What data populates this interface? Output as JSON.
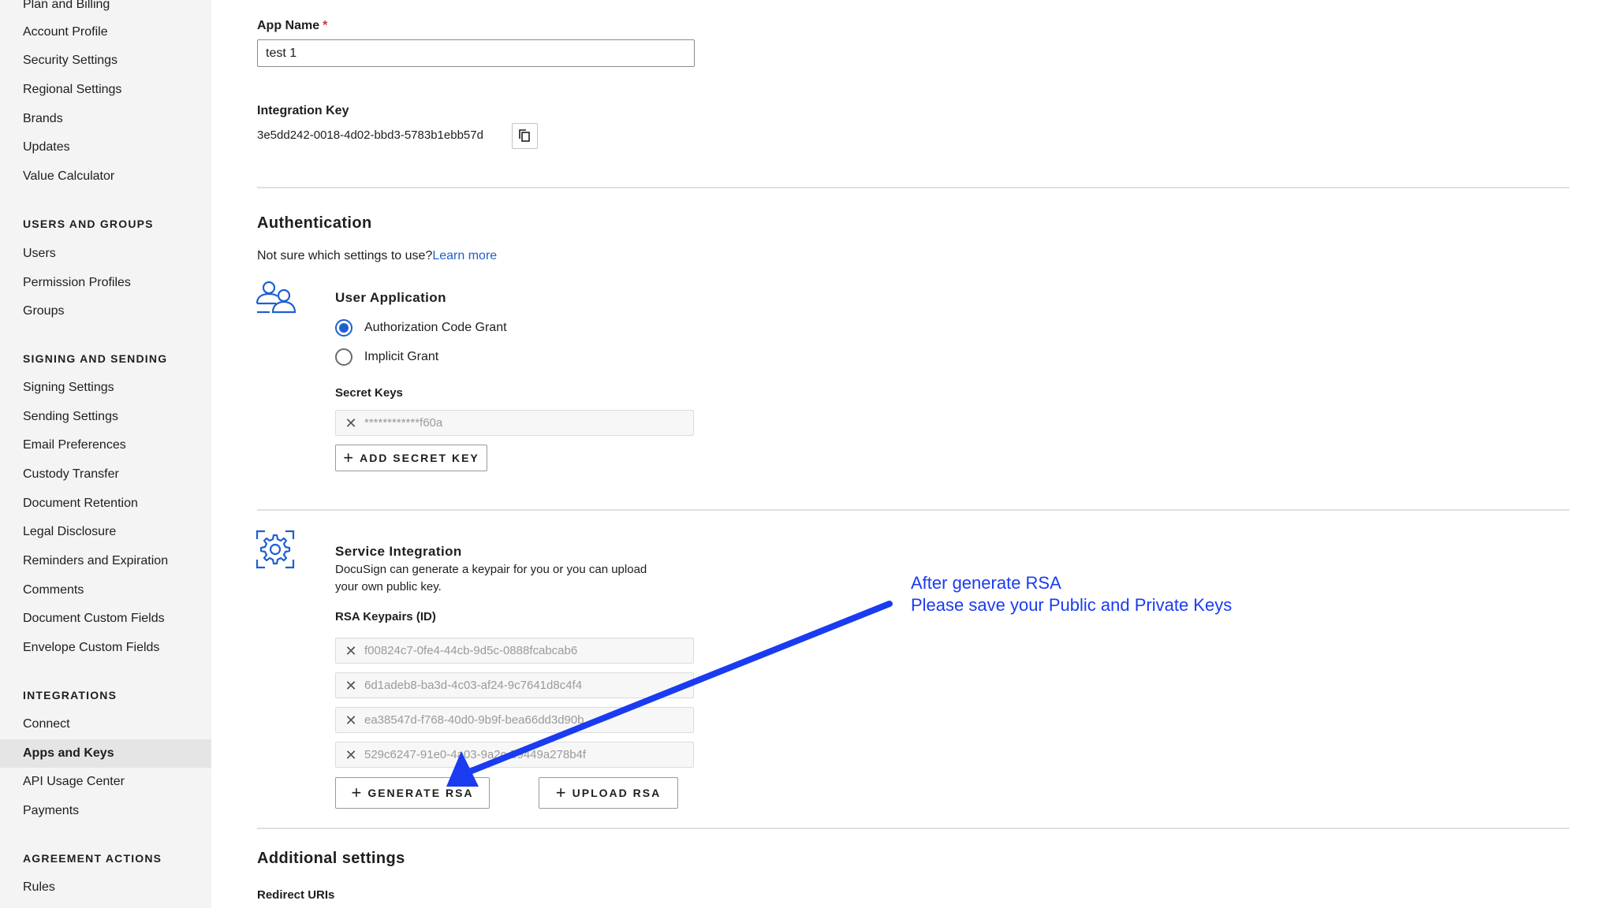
{
  "sidebar": {
    "items_top": [
      {
        "label": "Plan and Billing"
      },
      {
        "label": "Account Profile"
      },
      {
        "label": "Security Settings"
      },
      {
        "label": "Regional Settings"
      },
      {
        "label": "Brands"
      },
      {
        "label": "Updates"
      },
      {
        "label": "Value Calculator"
      }
    ],
    "users_groups": {
      "header": "USERS AND GROUPS",
      "items": [
        {
          "label": "Users"
        },
        {
          "label": "Permission Profiles"
        },
        {
          "label": "Groups"
        }
      ]
    },
    "signing_sending": {
      "header": "SIGNING AND SENDING",
      "items": [
        {
          "label": "Signing Settings"
        },
        {
          "label": "Sending Settings"
        },
        {
          "label": "Email Preferences"
        },
        {
          "label": "Custody Transfer"
        },
        {
          "label": "Document Retention"
        },
        {
          "label": "Legal Disclosure"
        },
        {
          "label": "Reminders and Expiration"
        },
        {
          "label": "Comments"
        },
        {
          "label": "Document Custom Fields"
        },
        {
          "label": "Envelope Custom Fields"
        }
      ]
    },
    "integrations": {
      "header": "INTEGRATIONS",
      "items": [
        {
          "label": "Connect"
        },
        {
          "label": "Apps and Keys",
          "active": true
        },
        {
          "label": "API Usage Center"
        },
        {
          "label": "Payments"
        }
      ]
    },
    "agreement_actions": {
      "header": "AGREEMENT ACTIONS",
      "items": [
        {
          "label": "Rules"
        }
      ]
    }
  },
  "app_name": {
    "label": "App Name",
    "required_mark": "*",
    "value": "test 1"
  },
  "integration_key": {
    "label": "Integration Key",
    "value": "3e5dd242-0018-4d02-bbd3-5783b1ebb57d",
    "copy_icon": "copy-icon"
  },
  "authentication": {
    "title": "Authentication",
    "help_text": "Not sure which settings to use?",
    "learn_more": "Learn more",
    "user_application": {
      "icon": "users-icon",
      "title": "User Application",
      "options": [
        {
          "label": "Authorization Code Grant",
          "checked": true
        },
        {
          "label": "Implicit Grant",
          "checked": false
        }
      ],
      "secret_keys_label": "Secret Keys",
      "secret_keys": [
        "************f60a"
      ],
      "add_secret_key": "ADD SECRET KEY"
    }
  },
  "service_integration": {
    "icon": "gear-icon",
    "title": "Service Integration",
    "description_line1": "DocuSign can generate a keypair for you or you can upload",
    "description_line2": "your own public key.",
    "rsa_label": "RSA Keypairs (ID)",
    "rsa_keypairs": [
      "f00824c7-0fe4-44cb-9d5c-0888fcabcab6",
      "6d1adeb8-ba3d-4c03-af24-9c7641d8c4f4",
      "ea38547d-f768-40d0-9b9f-bea66dd3d90b",
      "529c6247-91e0-4a03-9a2c-59449a278b4f"
    ],
    "generate_rsa": "GENERATE RSA",
    "upload_rsa": "UPLOAD RSA"
  },
  "additional_settings": {
    "title": "Additional settings",
    "redirect_uris_label": "Redirect URIs"
  },
  "annotation": {
    "line1": "After generate RSA",
    "line2": "Please save your Public and Private Keys",
    "color": "#1a3bf0"
  },
  "colors": {
    "accent": "#1f5fd0",
    "required": "#d13239",
    "sidebar_bg": "#f4f4f4"
  }
}
